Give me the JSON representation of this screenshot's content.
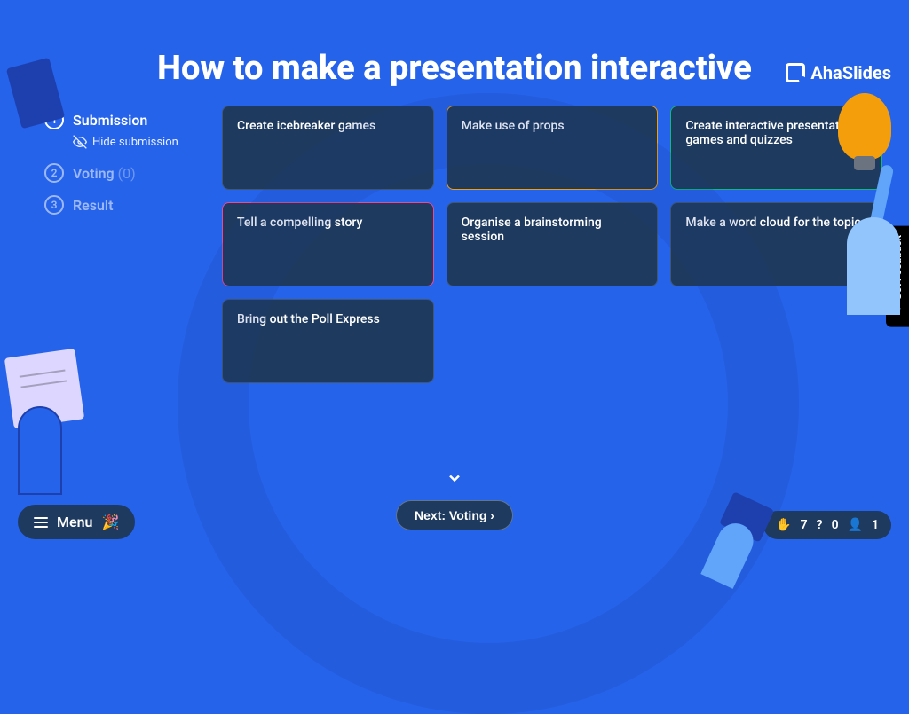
{
  "brand": "AhaSlides",
  "title": "How to make a presentation interactive",
  "steps": {
    "submission": {
      "num": "1",
      "label": "Submission"
    },
    "hide_submission": "Hide submission",
    "voting": {
      "num": "2",
      "label": "Voting",
      "count": "(0)"
    },
    "result": {
      "num": "3",
      "label": "Result"
    }
  },
  "cards": [
    "Create icebreaker games",
    "Make use of props",
    "Create interactive presentation games and quizzes",
    "Tell a compelling story",
    "Organise a brainstorming session",
    "Make a word cloud for the topic",
    "Bring out the Poll Express"
  ],
  "next_button": "Next: Voting ›",
  "menu_label": "Menu",
  "feedback_label": "Get Feedback",
  "status": {
    "hands": "7",
    "questions": "0",
    "participants": "1"
  }
}
